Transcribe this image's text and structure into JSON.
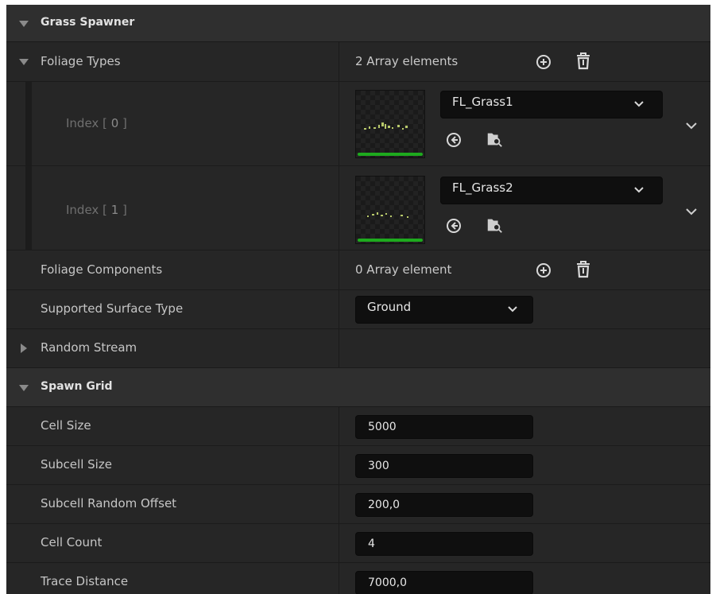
{
  "sections": {
    "grass_spawner": "Grass Spawner",
    "spawn_grid": "Spawn Grid"
  },
  "foliage_types": {
    "label": "Foliage Types",
    "count_text": "2 Array elements",
    "items": [
      {
        "index_prefix": "Index [ ",
        "index_value": "0",
        "index_suffix": " ]",
        "asset": "FL_Grass1"
      },
      {
        "index_prefix": "Index [ ",
        "index_value": "1",
        "index_suffix": " ]",
        "asset": "FL_Grass2"
      }
    ]
  },
  "foliage_components": {
    "label": "Foliage Components",
    "count_text": "0 Array element"
  },
  "supported_surface_type": {
    "label": "Supported Surface Type",
    "value": "Ground"
  },
  "random_stream": {
    "label": "Random Stream"
  },
  "spawn_grid_props": [
    {
      "label": "Cell Size",
      "value": "5000"
    },
    {
      "label": "Subcell Size",
      "value": "300"
    },
    {
      "label": "Subcell Random Offset",
      "value": "200,0"
    },
    {
      "label": "Cell Count",
      "value": "4"
    },
    {
      "label": "Trace Distance",
      "value": "7000,0"
    }
  ],
  "icons": {
    "add": "add-circle-icon",
    "delete": "trash-icon",
    "use_selected": "arrow-left-circle-icon",
    "browse": "folder-search-icon",
    "dropdown": "chevron-down-icon",
    "expand": "triangle-icon"
  },
  "colors": {
    "panel_bg": "#242424",
    "header_bg": "#2f2f2f",
    "field_bg": "#0f0f0f",
    "thumbnail_bar": "#1eaa1e"
  }
}
